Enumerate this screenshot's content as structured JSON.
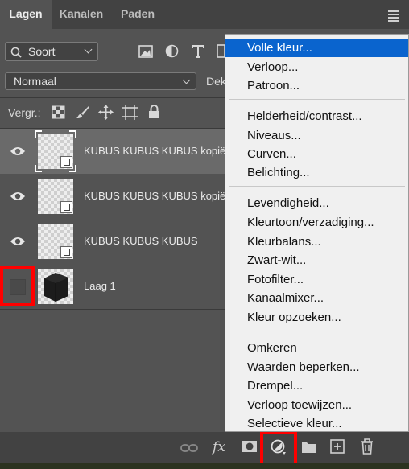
{
  "tabs": [
    {
      "label": "Lagen",
      "active": true
    },
    {
      "label": "Kanalen",
      "active": false
    },
    {
      "label": "Paden",
      "active": false
    }
  ],
  "filter": {
    "label": "Soort"
  },
  "blend_mode": {
    "value": "Normaal"
  },
  "opacity": {
    "label_partial": "Dek"
  },
  "lock": {
    "label": "Vergr.:"
  },
  "layers": [
    {
      "name": "KUBUS KUBUS KUBUS kopiër",
      "visible": true,
      "selected": true,
      "type": "smart-object"
    },
    {
      "name": "KUBUS KUBUS KUBUS kopiër",
      "visible": true,
      "selected": false,
      "type": "smart-object"
    },
    {
      "name": "KUBUS KUBUS KUBUS",
      "visible": true,
      "selected": false,
      "type": "smart-object"
    },
    {
      "name": "Laag 1",
      "visible": false,
      "selected": false,
      "type": "pixel"
    }
  ],
  "bottom_bar": {
    "fx_label": "fx"
  },
  "menu": {
    "groups": [
      [
        "Volle kleur...",
        "Verloop...",
        "Patroon..."
      ],
      [
        "Helderheid/contrast...",
        "Niveaus...",
        "Curven...",
        "Belichting..."
      ],
      [
        "Levendigheid...",
        "Kleurtoon/verzadiging...",
        "Kleurbalans...",
        "Zwart-wit...",
        "Fotofilter...",
        "Kanaalmixer...",
        "Kleur opzoeken..."
      ],
      [
        "Omkeren",
        "Waarden beperken...",
        "Drempel...",
        "Verloop toewijzen...",
        "Selectieve kleur..."
      ]
    ],
    "highlighted": "Volle kleur..."
  },
  "colors": {
    "panel": "#535353",
    "tabbar": "#424242",
    "highlight": "#0a64ce",
    "annotation": "#ff0000"
  }
}
